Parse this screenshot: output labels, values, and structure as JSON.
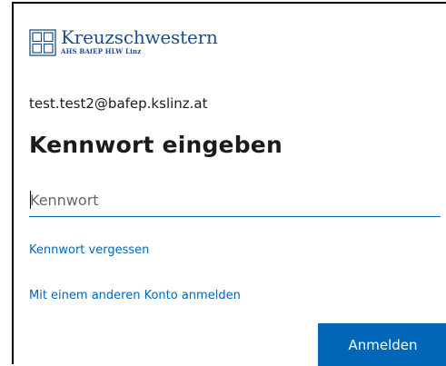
{
  "brand": {
    "name": "Kreuzschwestern",
    "subtitle": "AHS BAfEP HLW Linz",
    "color": "#1f4e86"
  },
  "account": {
    "email": "test.test2@bafep.kslinz.at"
  },
  "page": {
    "title": "Kennwort eingeben"
  },
  "password": {
    "placeholder": "Kennwort",
    "value": ""
  },
  "links": {
    "forgot": "Kennwort vergessen",
    "other_account": "Mit einem anderen Konto anmelden"
  },
  "actions": {
    "signin_label": "Anmelden"
  },
  "colors": {
    "accent": "#0067b8",
    "text": "#1b1b1b"
  }
}
